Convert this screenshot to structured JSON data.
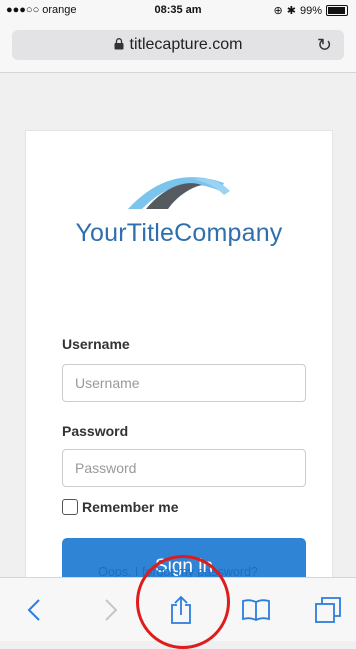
{
  "status_bar": {
    "carrier": "●●●○○ orange",
    "time": "08:35 am",
    "battery": "99%",
    "battery_level": 0.99
  },
  "browser": {
    "url": "titlecapture.com"
  },
  "logo": {
    "text_your": "Your",
    "text_title": "Title",
    "text_company": "Company",
    "colors": {
      "swoosh_light": "#7bc4ee",
      "swoosh_dark": "#555a60",
      "text": "#2f6fae"
    }
  },
  "form": {
    "username_label": "Username",
    "username_placeholder": "Username",
    "password_label": "Password",
    "password_placeholder": "Password",
    "remember_label": "Remember me",
    "signin_label": "Sign in",
    "forgot_link": "Oops, I forgot my password?"
  },
  "toolbar": {
    "items": [
      "back-icon",
      "forward-icon",
      "share-icon",
      "bookmarks-icon",
      "tabs-icon"
    ]
  },
  "colors": {
    "accent": "#2f84d6",
    "link": "#1a6fc2",
    "annotation": "#e01b1b"
  }
}
